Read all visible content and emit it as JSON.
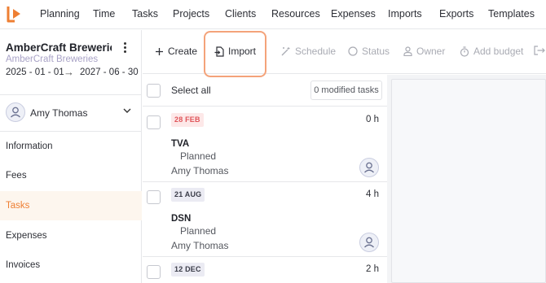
{
  "nav": {
    "logo": "app-logo-icon",
    "items": [
      "Planning",
      "Time",
      "Tasks",
      "Projects",
      "Clients",
      "Resources",
      "Expenses",
      "Imports",
      "Exports",
      "Templates"
    ]
  },
  "sidebar": {
    "org_name": "AmberCraft Brewerie...",
    "org_sub": "AmberCraft Breweries",
    "date_start": "2025 - 01 - 01",
    "date_arrow": "→",
    "date_end": "2027 - 06 - 30",
    "user": "Amy Thomas",
    "items": [
      "Information",
      "Fees",
      "Tasks",
      "Expenses",
      "Invoices"
    ],
    "active_item": "Tasks"
  },
  "toolbar": {
    "create": "Create",
    "import": "Import",
    "schedule": "Schedule",
    "status": "Status",
    "owner": "Owner",
    "add_budget": "Add budget"
  },
  "list": {
    "select_all": "Select all",
    "modified": "0 modified tasks",
    "tasks": [
      {
        "date": "28 FEB",
        "hours": "0 h",
        "code": "TVA",
        "status": "Planned",
        "owner": "Amy Thomas"
      },
      {
        "date": "21 AUG",
        "hours": "4 h",
        "code": "DSN",
        "status": "Planned",
        "owner": "Amy Thomas"
      },
      {
        "date": "12 DEC",
        "hours": "2 h"
      }
    ]
  },
  "colors": {
    "accent": "#ee7f33",
    "highlight": "#f4a37a",
    "overdue_badge_bg": "#fde8e8",
    "overdue_badge_text": "#e0555a",
    "badge_bg": "#ebebf3",
    "badge_text": "#3a3c48"
  }
}
